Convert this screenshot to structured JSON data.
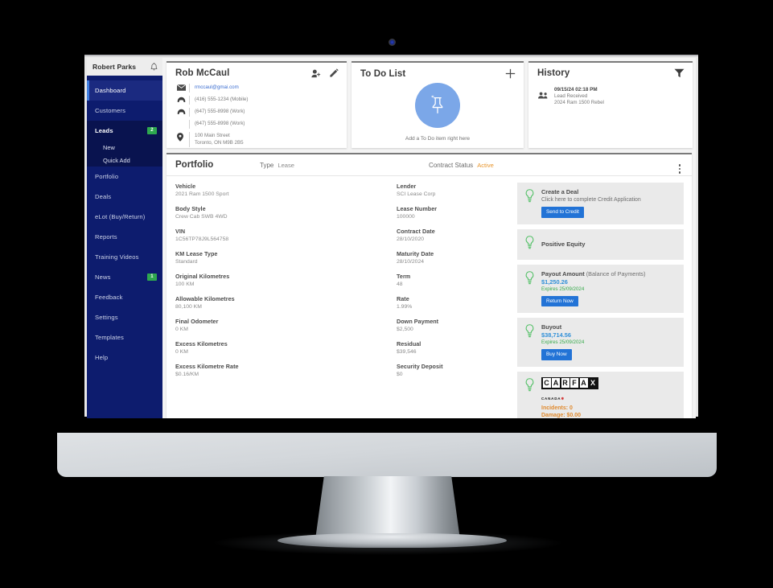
{
  "sidebar": {
    "user_name": "Robert Parks",
    "bell_icon": "bell-icon",
    "items": [
      {
        "label": "Dashboard",
        "state": "active-top",
        "badge": null
      },
      {
        "label": "Customers",
        "state": "normal",
        "badge": null
      },
      {
        "label": "Leads",
        "state": "current",
        "badge": "2"
      },
      {
        "label": "Portfolio",
        "state": "normal",
        "badge": null
      },
      {
        "label": "Deals",
        "state": "normal",
        "badge": null
      },
      {
        "label": "eLot (Buy/Return)",
        "state": "normal",
        "badge": null
      },
      {
        "label": "Reports",
        "state": "normal",
        "badge": null
      },
      {
        "label": "Training Videos",
        "state": "normal",
        "badge": null
      },
      {
        "label": "News",
        "state": "normal",
        "badge": "1"
      },
      {
        "label": "Feedback",
        "state": "normal",
        "badge": null
      },
      {
        "label": "Settings",
        "state": "normal",
        "badge": null
      },
      {
        "label": "Templates",
        "state": "normal",
        "badge": null
      },
      {
        "label": "Help",
        "state": "normal",
        "badge": null
      }
    ],
    "sub_items": [
      {
        "label": "New"
      },
      {
        "label": "Quick Add"
      }
    ]
  },
  "profile": {
    "title": "Rob McCaul",
    "add_user_icon": "add-user-icon",
    "edit_icon": "pencil-edit-icon",
    "contacts": [
      {
        "icon": "envelope-icon",
        "text": "rmccaul@gmai.com",
        "link": true
      },
      {
        "icon": "phone-icon",
        "text": "(416) 555-1234 (Mobile)",
        "link": false
      },
      {
        "icon": "phone-icon",
        "text": "(647) 555-8998 (Work)",
        "link": false
      },
      {
        "icon": "none",
        "text": "(647) 555-8998 (Work)",
        "link": false
      },
      {
        "icon": "map-pin-icon",
        "text": "100 Main Street\nToronto, ON M9B 2B5",
        "link": false
      }
    ]
  },
  "todo": {
    "title": "To Do List",
    "add_icon": "plus-icon",
    "empty_icon": "pushpin-icon",
    "empty_text": "Add a To Do item right here",
    "circle_color": "#7ba7e8"
  },
  "history": {
    "title": "History",
    "filter_icon": "funnel-filter-icon",
    "items": [
      {
        "icon": "people-icon",
        "timestamp": "09/15/24 02:18 PM",
        "event": "Lead Received",
        "detail": "2024 Ram 1500 Rebel"
      }
    ]
  },
  "portfolio": {
    "title": "Portfolio",
    "type_label": "Type",
    "type_value": "Lease",
    "status_label": "Contract Status",
    "status_value": "Active",
    "status_color": "#e8962e",
    "menu_icon": "kebab-menu-icon",
    "left_column": [
      {
        "label": "Vehicle",
        "value": "2021 Ram 1500 Sport"
      },
      {
        "label": "Body Style",
        "value": "Crew Cab SWB 4WD"
      },
      {
        "label": "VIN",
        "value": "1C56TP78J9L564758"
      },
      {
        "label": "KM Lease Type",
        "value": "Standard"
      },
      {
        "label": "Original Kilometres",
        "value": "100 KM"
      },
      {
        "label": "Allowable Kilometres",
        "value": "80,100 KM"
      },
      {
        "label": "Final Odometer",
        "value": "0 KM"
      },
      {
        "label": "Excess Kilometres",
        "value": "0 KM"
      },
      {
        "label": "Excess Kilometre Rate",
        "value": "$0.16/KM"
      }
    ],
    "mid_column": [
      {
        "label": "Lender",
        "value": "SCI Lease Corp"
      },
      {
        "label": "Lease Number",
        "value": "100000"
      },
      {
        "label": "Contract Date",
        "value": "28/10/2020"
      },
      {
        "label": "Maturity Date",
        "value": "28/10/2024"
      },
      {
        "label": "Term",
        "value": "48"
      },
      {
        "label": "Rate",
        "value": "1.99%"
      },
      {
        "label": "Down Payment",
        "value": "$2,500"
      },
      {
        "label": "Residual",
        "value": "$39,546"
      },
      {
        "label": "Security Deposit",
        "value": "$0"
      }
    ]
  },
  "actions": {
    "bulb_icon": "lightbulb-icon",
    "create_deal": {
      "title": "Create a Deal",
      "subtitle": "Click here to complete Credit Application",
      "button": "Send to Credit"
    },
    "positive_equity": {
      "title": "Positive Equity"
    },
    "payout": {
      "title": "Payout Amount",
      "title_soft": "(Balance of Payments)",
      "amount": "$1,250.26",
      "expires": "Expires 25/09/2024",
      "button": "Return Now"
    },
    "buyout": {
      "title": "Buyout",
      "amount": "$38,714.56",
      "expires": "Expires 25/09/2024",
      "button": "Buy Now"
    },
    "carfax": {
      "logo_letters": [
        "C",
        "A",
        "R",
        "F",
        "A",
        "X"
      ],
      "sub": "CANADA",
      "incidents": "Incidents: 0",
      "damage": "Damage: $0.00"
    }
  }
}
